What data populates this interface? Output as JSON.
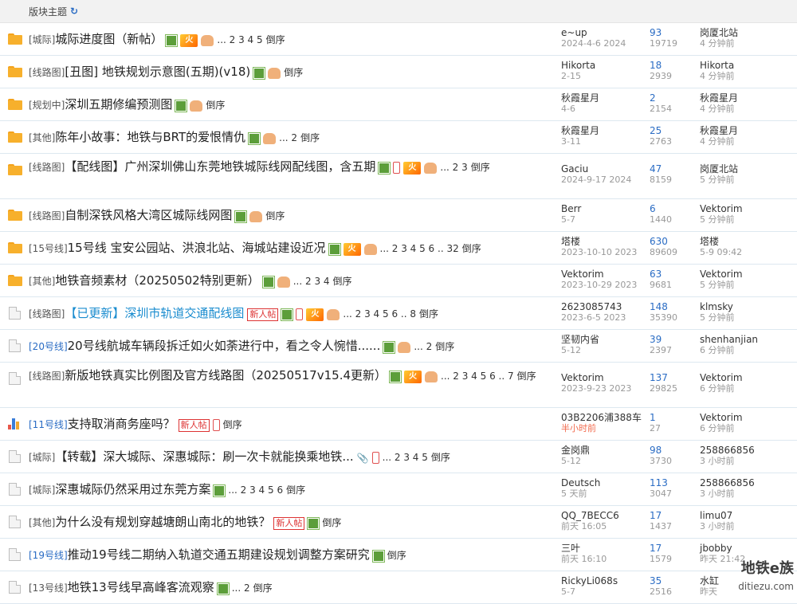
{
  "header": {
    "title": "版块主题",
    "refresh_icon": "refresh-icon"
  },
  "threads": [
    {
      "icon": "folder",
      "tag": "[城际]",
      "title": "城际进度图（新帖）",
      "icons": [
        "img",
        "hot",
        "thumb"
      ],
      "pages": "... 2 3 4 5",
      "desc": "倒序",
      "author": "e~up",
      "date": "2024-4-6 2024",
      "replies": "93",
      "views": "19719",
      "last_user": "岗厦北站",
      "last_time": "4 分钟前"
    },
    {
      "icon": "folder",
      "tag": "[线路图]",
      "title": "[丑图] 地铁规划示意图(五期)(v18)",
      "icons": [
        "img",
        "thumb"
      ],
      "pages": "",
      "desc": "倒序",
      "author": "Hikorta",
      "date": "2-15",
      "replies": "18",
      "views": "2939",
      "last_user": "Hikorta",
      "last_time": "4 分钟前"
    },
    {
      "icon": "folder",
      "tag": "[规划中]",
      "title": "深圳五期修编预测图",
      "icons": [
        "img",
        "thumb"
      ],
      "pages": "",
      "desc": "倒序",
      "author": "秋霞星月",
      "date": "4-6",
      "replies": "2",
      "views": "2154",
      "last_user": "秋霞星月",
      "last_time": "4 分钟前"
    },
    {
      "icon": "folder",
      "tag": "[其他]",
      "title": "陈年小故事：地铁与BRT的爱恨情仇",
      "icons": [
        "img",
        "thumb"
      ],
      "pages": "... 2",
      "desc": "倒序",
      "author": "秋霞星月",
      "date": "3-11",
      "replies": "25",
      "views": "2763",
      "last_user": "秋霞星月",
      "last_time": "4 分钟前"
    },
    {
      "icon": "folder",
      "tag": "[线路图]",
      "title": "【配线图】广州深圳佛山东莞地铁城际线网配线图，含五期",
      "icons": [
        "img",
        "phone",
        "hot",
        "thumb"
      ],
      "pages": "... 2 3",
      "desc": "倒序",
      "author": "Gaciu",
      "date": "2024-9-17 2024",
      "replies": "47",
      "views": "8159",
      "last_user": "岗厦北站",
      "last_time": "5 分钟前"
    },
    {
      "icon": "folder",
      "tag": "[线路图]",
      "title": "自制深铁风格大湾区城际线网图",
      "icons": [
        "img",
        "thumb"
      ],
      "pages": "",
      "desc": "倒序",
      "author": "Berr",
      "date": "5-7",
      "replies": "6",
      "views": "1440",
      "last_user": "Vektorim",
      "last_time": "5 分钟前"
    },
    {
      "icon": "folder",
      "tag": "[15号线]",
      "title": "15号线 宝安公园站、洪浪北站、海城站建设近况",
      "icons": [
        "img",
        "hot",
        "thumb"
      ],
      "pages": "... 2 3 4 5 6 .. 32",
      "desc": "倒序",
      "author": "塔楼",
      "date": "2023-10-10 2023",
      "replies": "630",
      "views": "89609",
      "last_user": "塔楼",
      "last_time": "5-9 09:42"
    },
    {
      "icon": "folder",
      "tag": "[其他]",
      "title": "地铁音频素材（20250502特别更新）",
      "icons": [
        "img",
        "thumb"
      ],
      "pages": "... 2 3 4",
      "desc": "倒序",
      "author": "Vektorim",
      "date": "2023-10-29 2023",
      "replies": "63",
      "views": "9681",
      "last_user": "Vektorim",
      "last_time": "5 分钟前"
    },
    {
      "icon": "doc",
      "tag": "[线路图]",
      "title": "【已更新】深圳市轨道交通配线图",
      "hl": true,
      "icons": [
        "new",
        "img",
        "phone",
        "hot",
        "thumb"
      ],
      "pages": "... 2 3 4 5 6 .. 8",
      "desc": "倒序",
      "author": "2623085743",
      "date": "2023-6-5 2023",
      "replies": "148",
      "views": "35390",
      "last_user": "klmsky",
      "last_time": "5 分钟前"
    },
    {
      "icon": "doc",
      "tag": "[20号线]",
      "tag_blue": true,
      "title": "20号线航城车辆段拆迁如火如荼进行中，看之令人惋惜......",
      "icons": [
        "img",
        "thumb"
      ],
      "pages": "... 2",
      "desc": "倒序",
      "author": "坚韧内省",
      "date": "5-12",
      "replies": "39",
      "views": "2397",
      "last_user": "shenhanjian",
      "last_time": "6 分钟前"
    },
    {
      "icon": "doc",
      "tag": "[线路图]",
      "title": "新版地铁真实比例图及官方线路图（20250517v15.4更新）",
      "icons": [
        "img",
        "hot",
        "thumb"
      ],
      "pages": "... 2 3 4 5 6 .. 7",
      "desc": "倒序",
      "author": "Vektorim",
      "date": "2023-9-23 2023",
      "replies": "137",
      "views": "29825",
      "last_user": "Vektorim",
      "last_time": "6 分钟前"
    },
    {
      "icon": "poll",
      "tag": "[11号线]",
      "tag_blue": true,
      "title": "支持取消商务座吗？",
      "icons": [
        "new",
        "phone"
      ],
      "pages": "",
      "desc": "倒序",
      "author": "03B2206浦388车",
      "date": "半小时前",
      "date_red": true,
      "replies": "1",
      "views": "27",
      "last_user": "Vektorim",
      "last_time": "6 分钟前"
    },
    {
      "icon": "doc",
      "tag": "[城际]",
      "title": "【转载】深大城际、深惠城际：刷一次卡就能换乘地铁...",
      "icons": [
        "clip",
        "phone"
      ],
      "pages": "... 2 3 4 5",
      "desc": "倒序",
      "author": "金岗鼎",
      "date": "5-12",
      "replies": "98",
      "views": "3730",
      "last_user": "258866856",
      "last_time": "3 小时前"
    },
    {
      "icon": "doc",
      "tag": "[城际]",
      "title": "深惠城际仍然采用过东莞方案",
      "icons": [
        "img"
      ],
      "pages": "... 2 3 4 5 6",
      "desc": "倒序",
      "author": "Deutsch",
      "date": "5 天前",
      "replies": "113",
      "views": "3047",
      "last_user": "258866856",
      "last_time": "3 小时前"
    },
    {
      "icon": "doc",
      "tag": "[其他]",
      "title": "为什么没有规划穿越塘朗山南北的地铁？",
      "icons": [
        "new",
        "img"
      ],
      "pages": "",
      "desc": "倒序",
      "author": "QQ_7BECC6",
      "date": "前天 16:05",
      "replies": "17",
      "views": "1437",
      "last_user": "limu07",
      "last_time": "3 小时前"
    },
    {
      "icon": "doc",
      "tag": "[19号线]",
      "tag_blue": true,
      "title": "推动19号线二期纳入轨道交通五期建设规划调整方案研究",
      "icons": [
        "img"
      ],
      "pages": "",
      "desc": "倒序",
      "author": "三叶",
      "date": "前天 16:10",
      "replies": "17",
      "views": "1579",
      "last_user": "jbobby",
      "last_time": "昨天 21:42"
    },
    {
      "icon": "doc",
      "tag": "[13号线]",
      "title": "地铁13号线早高峰客流观察",
      "icons": [
        "img"
      ],
      "pages": "... 2",
      "desc": "倒序",
      "author": "RickyLi068s",
      "date": "5-7",
      "replies": "35",
      "views": "2516",
      "last_user": "水缸",
      "last_time": "昨天"
    }
  ],
  "labels": {
    "new_post": "新人帖",
    "hot": "火"
  },
  "watermark": {
    "text": "地铁e族",
    "sub": "ditiezu.com"
  }
}
